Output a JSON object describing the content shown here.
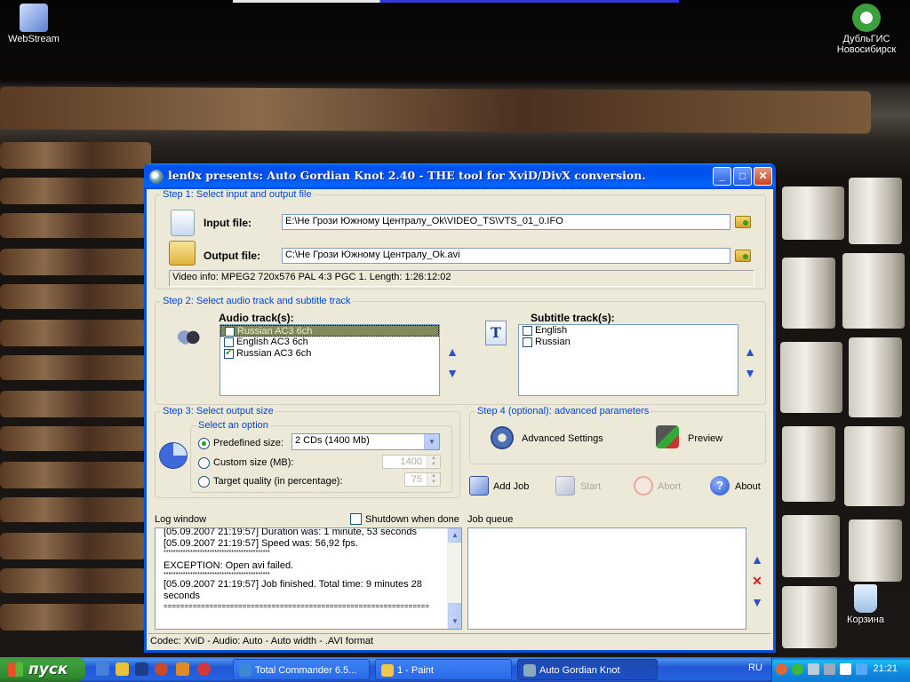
{
  "desktop": {
    "icons": [
      {
        "label": "WebStream"
      },
      {
        "label": "ДубльГИС Новосибирск"
      },
      {
        "label": "Корзина"
      }
    ]
  },
  "window": {
    "title": "len0x presents: Auto Gordian Knot 2.40 - THE tool for XviD/DivX conversion.",
    "step1": {
      "legend": "Step 1: Select input and output file",
      "input_label": "Input file:",
      "input_value": "E:\\Не Грози Южному Централу_Ok\\VIDEO_TS\\VTS_01_0.IFO",
      "output_label": "Output file:",
      "output_value": "C:\\Не Грози Южному Централу_Ok.avi",
      "video_info": "Video info: MPEG2 720x576 PAL 4:3   PGC 1. Length: 1:26:12:02"
    },
    "step2": {
      "legend": "Step 2: Select audio track and subtitle track",
      "audio_label": "Audio track(s):",
      "audio_tracks": [
        {
          "label": "Russian AC3 6ch",
          "checked": false,
          "selected": true
        },
        {
          "label": "English AC3 6ch",
          "checked": false,
          "selected": false
        },
        {
          "label": "Russian AC3 6ch",
          "checked": true,
          "selected": false
        }
      ],
      "subtitle_label": "Subtitle track(s):",
      "subtitle_tracks": [
        {
          "label": "English",
          "checked": false
        },
        {
          "label": "Russian",
          "checked": false
        }
      ]
    },
    "step3": {
      "legend": "Step 3: Select output size",
      "option_legend": "Select an option",
      "predefined_label": "Predefined size:",
      "predefined_value": "2 CDs (1400 Mb)",
      "custom_label": "Custom size (MB):",
      "custom_value": "1400",
      "quality_label": "Target quality (in percentage):",
      "quality_value": "75"
    },
    "step4": {
      "legend": "Step 4 (optional): advanced parameters",
      "advanced_label": "Advanced Settings",
      "preview_label": "Preview"
    },
    "actions": {
      "add_job": "Add Job",
      "start": "Start",
      "abort": "Abort",
      "about": "About"
    },
    "log": {
      "label": "Log window",
      "shutdown_label": "Shutdown when done",
      "lines": [
        "[05.09.2007 21:19:57] Duration was: 1 minute, 53 seconds",
        "[05.09.2007 21:19:57] Speed was: 56,92 fps.",
        "********************************************",
        "",
        "EXCEPTION: Open avi failed.",
        "********************************************",
        "[05.09.2007 21:19:57] Job finished. Total time: 9 minutes 28",
        "seconds",
        "================================================================"
      ]
    },
    "queue": {
      "label": "Job queue"
    },
    "status": "Codec: XviD -  Audio: Auto -  Auto width - .AVI format"
  },
  "taskbar": {
    "start_label": "пуск",
    "tasks": [
      {
        "label": "Total Commander 6.5..."
      },
      {
        "label": "1 - Paint"
      },
      {
        "label": "Auto Gordian Knot"
      }
    ],
    "lang": "RU",
    "clock": "21:21"
  },
  "colors": {
    "titlebar": "#0054e3",
    "legend": "#0046d5",
    "window_bg": "#ece9d8",
    "start_green": "#3d9f3d"
  }
}
